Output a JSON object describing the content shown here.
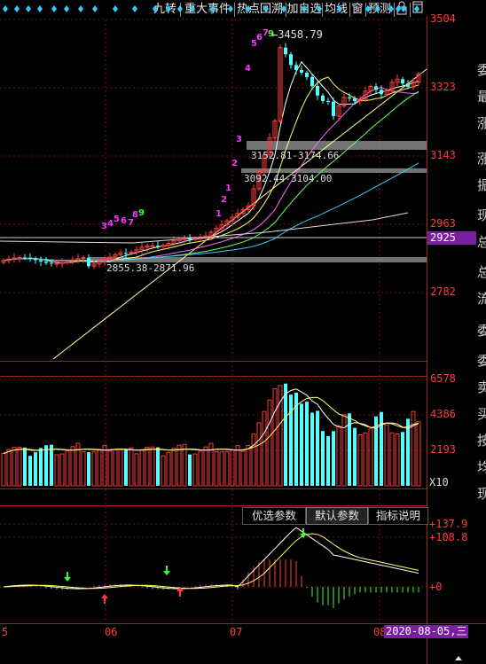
{
  "toolbar": {
    "items": [
      "九转",
      "重大事件",
      "热点回溯",
      "加自选",
      "均线",
      "窗",
      "预测"
    ],
    "lock_icon": "lock-icon",
    "window_icon": "window-icon"
  },
  "price_axis": {
    "labels": [
      "3504",
      "3323",
      "3143",
      "2963",
      "2782"
    ],
    "current_price": "2925"
  },
  "annotations": {
    "high_marker": "3458.79",
    "zone1": "3152.81-3174.66",
    "zone2": "3092.44-3104.00",
    "zone3": "2855.38-2871.96",
    "td_seq_left": [
      "3",
      "4",
      "5",
      "6",
      "7",
      "8",
      "9"
    ],
    "td_seq_up": [
      "1",
      "2",
      "3",
      "4",
      "5",
      "6",
      "7",
      "9"
    ],
    "td_seq_mid": [
      "1",
      "2"
    ]
  },
  "volume_axis": {
    "labels": [
      "6578",
      "4386",
      "2193"
    ],
    "unit": "X10"
  },
  "indicator": {
    "tabs": [
      "优选参数",
      "默认参数",
      "指标说明"
    ],
    "active_tab": "默认参数",
    "axis_labels": [
      "+137.9",
      "+108.8",
      "+0"
    ]
  },
  "time_axis": {
    "labels": [
      "5",
      "06",
      "07",
      "08"
    ],
    "current_date": "2020-08-05,三"
  },
  "right_panel_chars": [
    "委",
    "最",
    "涨",
    "涨",
    "振",
    "现",
    "总",
    "总",
    "流",
    "委",
    "委",
    "卖",
    "买",
    "按",
    "均",
    "现"
  ],
  "colors": {
    "up": "#ff3b3b",
    "down": "#54ffff",
    "ma5": "#ffffff",
    "ma10": "#ffff66",
    "ma20": "#ff66ff",
    "ma30": "#66ff66",
    "ma60": "#33ccff",
    "td_count": "#ff33ff",
    "td_nine": "#33ff33",
    "date_bg": "#7a1fa0"
  }
}
